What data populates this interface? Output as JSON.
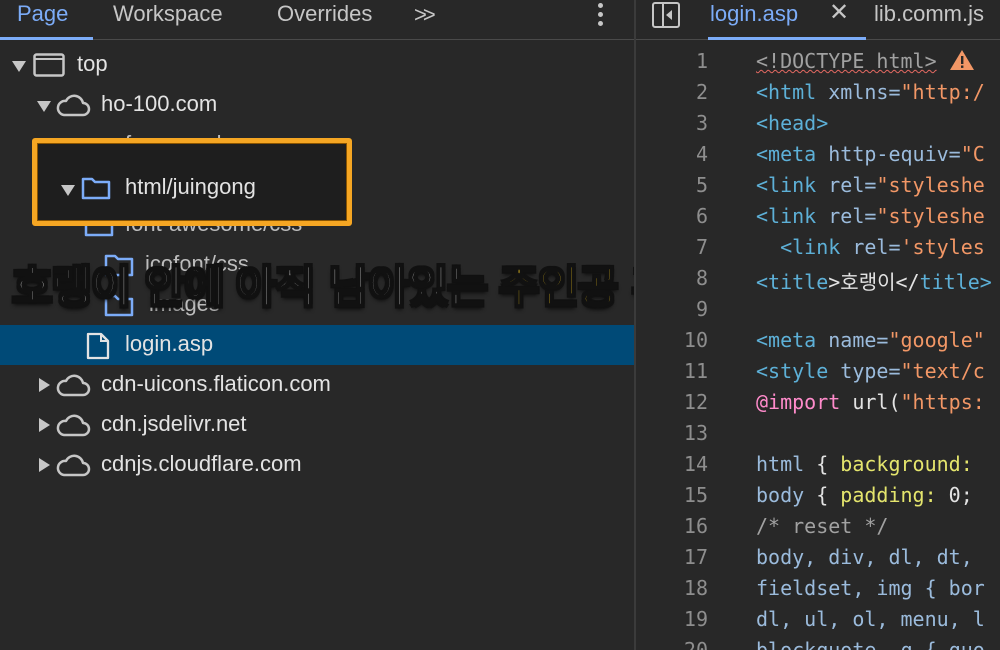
{
  "left_panel": {
    "tabs": [
      "Page",
      "Workspace",
      "Overrides"
    ],
    "more_tabs_icon": ">>",
    "tree": {
      "top": "top",
      "domain": "ho-100.com",
      "framework": "framework",
      "folder_selected": "html/juingong",
      "font_awesome": "font-awesome/css",
      "icofont": "icofont/css",
      "images": "images",
      "file": "login.asp",
      "cdn1": "cdn-uicons.flaticon.com",
      "cdn2": "cdn.jsdelivr.net",
      "cdn3": "cdnjs.cloudflare.com"
    }
  },
  "caption": {
    "part1": "호랭이 안에",
    "part2": "아직 남아있는",
    "part3": "주인공 흔적",
    "colors": {
      "white": "#ffffff",
      "yellow": "#ffd21f"
    }
  },
  "right_panel": {
    "open_file": "login.asp",
    "close_glyph": "✕",
    "other_file": "lib.comm.js",
    "lines": [
      {
        "n": "1",
        "a": "<!DOCTYPE html>"
      },
      {
        "n": "2",
        "a": "<html",
        "b": " xmlns=",
        "c": "\"http:/"
      },
      {
        "n": "3",
        "a": "<head>"
      },
      {
        "n": "4",
        "a": "<meta",
        "b": " http-equiv=",
        "c": "\"C"
      },
      {
        "n": "5",
        "a": "<link",
        "b": " rel=",
        "c": "\"styleshe"
      },
      {
        "n": "6",
        "a": "<link",
        "b": " rel=",
        "c": "\"styleshe"
      },
      {
        "n": "7",
        "a": "  <link",
        "b": " rel=",
        "c": "'styles"
      },
      {
        "n": "8",
        "a": "<title",
        "b": ">호랭이</",
        "c": "title>"
      },
      {
        "n": "9"
      },
      {
        "n": "10",
        "a": "<meta",
        "b": " name=",
        "c": "\"google\""
      },
      {
        "n": "11",
        "a": "<style",
        "b": " type=",
        "c": "\"text/c"
      },
      {
        "n": "12",
        "a": "@import",
        "b": " url(",
        "c": "\"https:"
      },
      {
        "n": "13"
      },
      {
        "n": "14",
        "a": "html",
        "b": " { ",
        "c": "background:"
      },
      {
        "n": "15",
        "a": "body",
        "b": " { ",
        "c": "padding:",
        "d": " 0;"
      },
      {
        "n": "16",
        "a": "/* reset */"
      },
      {
        "n": "17",
        "a": "body, div, dl, dt,"
      },
      {
        "n": "18",
        "a": "fieldset, img { bor"
      },
      {
        "n": "19",
        "a": "dl, ul, ol, menu, l"
      },
      {
        "n": "20",
        "a": "blockquote, q { quo"
      }
    ]
  }
}
